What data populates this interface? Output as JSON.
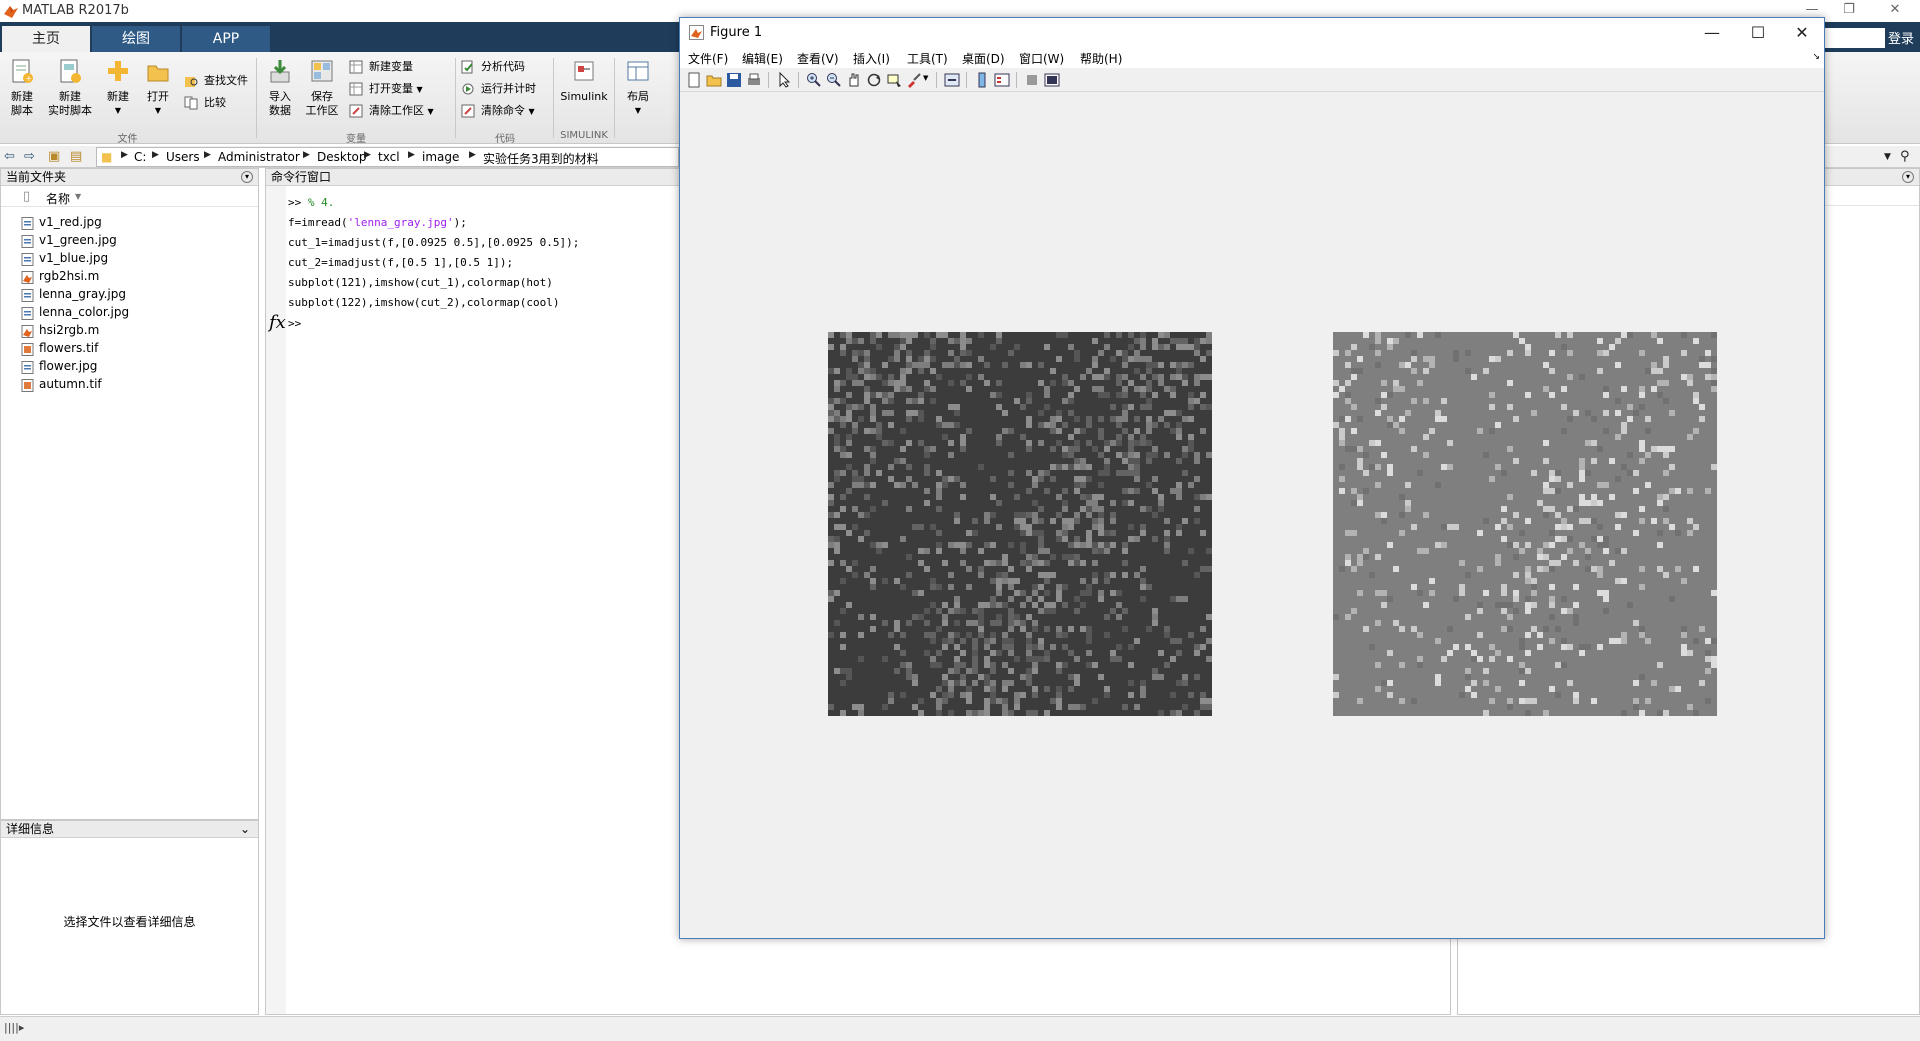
{
  "window": {
    "title": "MATLAB R2017b",
    "min": "—",
    "restore": "❐",
    "close": "✕"
  },
  "tabs": [
    "主页",
    "绘图",
    "APP"
  ],
  "login": "登录",
  "toolstrip": {
    "new_script": "新建\n脚本",
    "new_live_script": "新建\n实时脚本",
    "new": "新建",
    "open": "打开",
    "find_files": "查找文件",
    "compare": "比较",
    "import_data": "导入\n数据",
    "save_workspace": "保存\n工作区",
    "new_variable": "新建变量",
    "open_variable": "打开变量",
    "clear_workspace": "清除工作区",
    "analyze_code": "分析代码",
    "run_and_time": "运行并计时",
    "clear_commands": "清除命令",
    "simulink": "Simulink",
    "layout": "布局",
    "groups": {
      "file": "文件",
      "variable": "变量",
      "code": "代码",
      "simulink": "SIMULINK"
    }
  },
  "address": {
    "crumbs": [
      "C:",
      "Users",
      "Administrator",
      "Desktop",
      "txcl",
      "image",
      "实验任务3用到的材料"
    ]
  },
  "current_folder": {
    "title": "当前文件夹",
    "column": "名称",
    "files": [
      {
        "name": "v1_red.jpg",
        "icon": "image-file-icon"
      },
      {
        "name": "v1_green.jpg",
        "icon": "image-file-icon"
      },
      {
        "name": "v1_blue.jpg",
        "icon": "image-file-icon"
      },
      {
        "name": "rgb2hsi.m",
        "icon": "m-file-icon"
      },
      {
        "name": "lenna_gray.jpg",
        "icon": "image-file-icon"
      },
      {
        "name": "lenna_color.jpg",
        "icon": "image-file-icon"
      },
      {
        "name": "hsi2rgb.m",
        "icon": "m-file-icon"
      },
      {
        "name": "flowers.tif",
        "icon": "tif-file-icon"
      },
      {
        "name": "flower.jpg",
        "icon": "image-file-icon"
      },
      {
        "name": "autumn.tif",
        "icon": "tif-file-icon"
      }
    ]
  },
  "details": {
    "title": "详细信息",
    "message": "选择文件以查看详细信息"
  },
  "command_window": {
    "title": "命令行窗口",
    "prompt_line": {
      "prompt": ">> ",
      "comment": "% 4."
    },
    "line2": {
      "a": "f=imread(",
      "s": "'lenna_gray.jpg'",
      "b": ");"
    },
    "line3": "cut_1=imadjust(f,[0.0925 0.5],[0.0925 0.5]);",
    "line4": "cut_2=imadjust(f,[0.5 1],[0.5 1]);",
    "line5": "subplot(121),imshow(cut_1),colormap(hot)",
    "line6": "subplot(122),imshow(cut_2),colormap(cool)",
    "prompt": ">>",
    "fx": "fx"
  },
  "figure": {
    "title": "Figure 1",
    "menus": [
      "文件(F)",
      "编辑(E)",
      "查看(V)",
      "插入(I)",
      "工具(T)",
      "桌面(D)",
      "窗口(W)",
      "帮助(H)"
    ],
    "min": "—",
    "max": "☐",
    "close": "✕",
    "colors": {
      "img1_bg": "#3c3c3c",
      "img2_bg": "#7f7f7f"
    }
  }
}
